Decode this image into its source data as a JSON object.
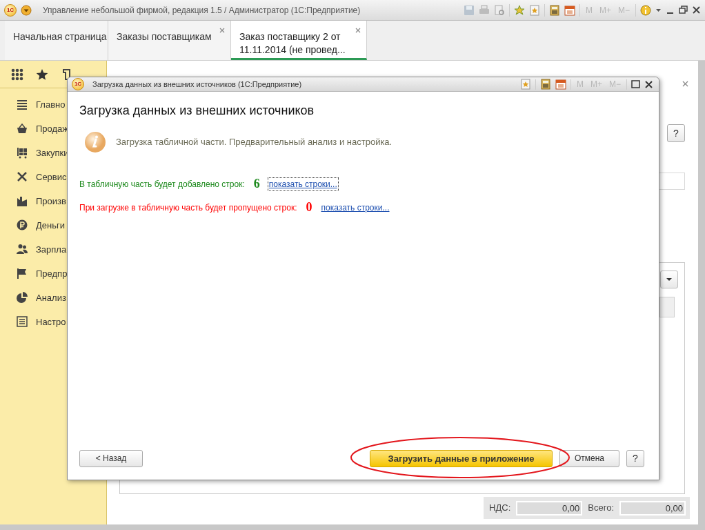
{
  "window": {
    "logo": "1С",
    "title": "Управление небольшой фирмой, редакция 1.5 / Администратор  (1С:Предприятие)",
    "memory_buttons": [
      "M",
      "M+",
      "M−"
    ]
  },
  "tabs": [
    {
      "label": "Начальная страница",
      "selected": false,
      "closable": false
    },
    {
      "label": "Заказы поставщикам",
      "selected": false,
      "closable": true
    },
    {
      "label": "Заказ поставщику 2 от 11.11.2014  (не провед...",
      "selected": true,
      "closable": true
    }
  ],
  "sidebar": {
    "items": [
      {
        "label": "Главно"
      },
      {
        "label": "Продаж"
      },
      {
        "label": "Закупки"
      },
      {
        "label": "Сервис"
      },
      {
        "label": "Произв"
      },
      {
        "label": "Деньги"
      },
      {
        "label": "Зарпла"
      },
      {
        "label": "Предпр"
      },
      {
        "label": "Анализ"
      },
      {
        "label": "Настро"
      }
    ]
  },
  "form": {
    "help_button": "?",
    "totals": [
      {
        "label": "НДС:",
        "value": "0,00"
      },
      {
        "label": "Всего:",
        "value": "0,00"
      }
    ]
  },
  "dialog": {
    "logo": "1С",
    "title": "Загрузка данных из внешних источников  (1С:Предприятие)",
    "memory_buttons": [
      "M",
      "M+",
      "M−"
    ],
    "heading": "Загрузка данных из внешних источников",
    "info": "Загрузка табличной части. Предварительный анализ и настройка.",
    "lines": [
      {
        "text": "В табличную часть будет добавлено строк:",
        "count": "6",
        "link": "показать строки...",
        "color": "#1e8a1e",
        "focused": true
      },
      {
        "text": "При загрузке в табличную часть будет пропущено строк:",
        "count": "0",
        "link": "показать строки...",
        "color": "#ff0000",
        "focused": false
      }
    ],
    "buttons": [
      {
        "kind": "back",
        "label": "< Назад"
      },
      {
        "kind": "primary",
        "label": "Загрузить данные в приложение",
        "highlighted": true
      },
      {
        "kind": "cancel",
        "label": "Отмена"
      },
      {
        "kind": "help",
        "label": "?"
      }
    ]
  }
}
